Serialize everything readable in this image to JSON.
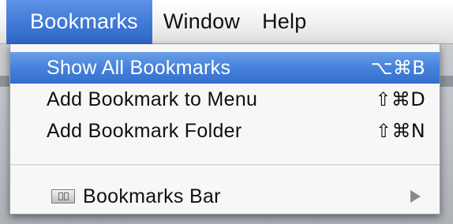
{
  "menubar": {
    "items": [
      {
        "label": "Bookmarks",
        "active": true
      },
      {
        "label": "Window"
      },
      {
        "label": "Help"
      }
    ]
  },
  "bookmarks_menu": {
    "items": [
      {
        "label": "Show All Bookmarks",
        "shortcut": "⌥⌘B",
        "highlighted": true
      },
      {
        "label": "Add Bookmark to Menu",
        "shortcut": "⇧⌘D"
      },
      {
        "label": "Add Bookmark Folder",
        "shortcut": "⇧⌘N"
      }
    ],
    "submenu_item": {
      "label": "Bookmarks Bar",
      "icon": "bookmarks-bar-icon",
      "has_submenu": true
    }
  },
  "colors": {
    "highlight": "#4682dc",
    "menubar_active": "#3f78d6"
  }
}
